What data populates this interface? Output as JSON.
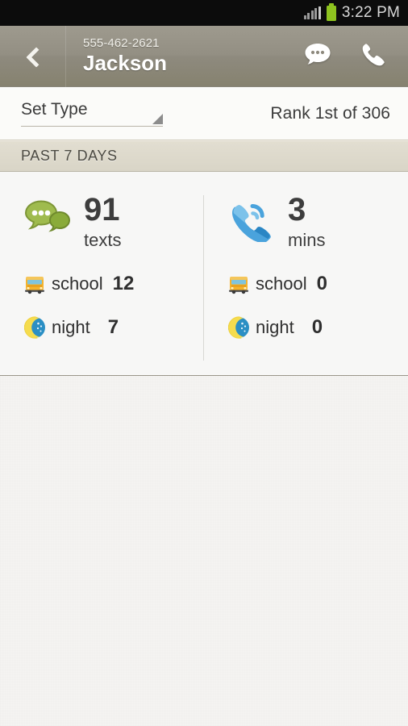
{
  "status_bar": {
    "time": "3:22 PM",
    "signal_icon": "signal-bars-icon",
    "battery_icon": "battery-icon",
    "battery_color": "#8ec31f"
  },
  "action_bar": {
    "back_icon": "chevron-left-icon",
    "phone_number": "555-462-2621",
    "contact_name": "Jackson",
    "message_icon": "chat-bubble-icon",
    "call_icon": "phone-handset-icon",
    "background_color": "#938f83"
  },
  "filter_bar": {
    "spinner_label": "Set Type",
    "spinner_arrow_icon": "triangle-down-icon",
    "rank_label": "Rank 1st of 306"
  },
  "section_header": {
    "title": "PAST 7 DAYS"
  },
  "stats": {
    "columns": [
      {
        "primary": {
          "icon": "chat-bubbles-icon",
          "icon_color": "#8aab3a",
          "value": "91",
          "unit": "texts"
        },
        "sub_rows": [
          {
            "icon": "school-bus-icon",
            "label": "school",
            "value": "12"
          },
          {
            "icon": "night-moon-icon",
            "label": "night",
            "value": "7"
          }
        ]
      },
      {
        "primary": {
          "icon": "phone-call-icon",
          "icon_color": "#3d9bd6",
          "value": "3",
          "unit": "mins"
        },
        "sub_rows": [
          {
            "icon": "school-bus-icon",
            "label": "school",
            "value": "0"
          },
          {
            "icon": "night-moon-icon",
            "label": "night",
            "value": "0"
          }
        ]
      }
    ]
  }
}
